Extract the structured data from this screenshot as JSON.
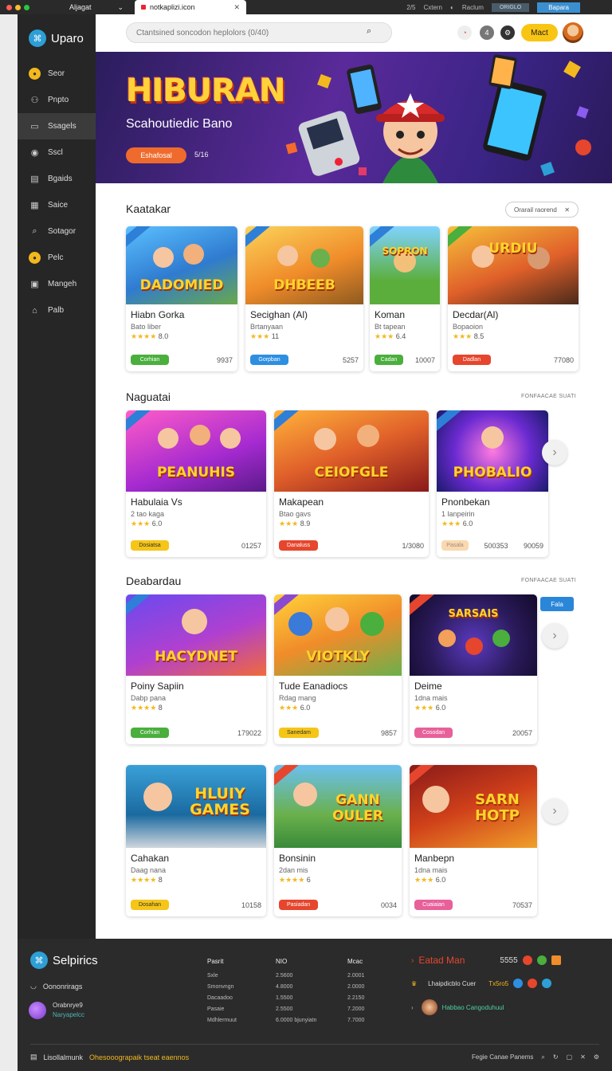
{
  "browser": {
    "tab_inactive": "Aljagat",
    "tab_active": "notkaplizi.icon",
    "right_items": [
      "2/5",
      "Cxtern",
      "Raclum"
    ],
    "btn1": "ORIGLO",
    "btn2": "Bapara"
  },
  "sidebar": {
    "brand": "Uparo",
    "items": [
      {
        "label": "Seor",
        "icon": "coin-icon"
      },
      {
        "label": "Pnpto",
        "icon": "user-icon"
      },
      {
        "label": "Ssagels",
        "icon": "chat-icon"
      },
      {
        "label": "Sscl",
        "icon": "disc-icon"
      },
      {
        "label": "Bgaids",
        "icon": "document-icon"
      },
      {
        "label": "Saice",
        "icon": "calendar-icon"
      },
      {
        "label": "Sotagor",
        "icon": "search-icon"
      },
      {
        "label": "Pelc",
        "icon": "coin-icon"
      },
      {
        "label": "Mangeh",
        "icon": "image-icon"
      },
      {
        "label": "Palb",
        "icon": "bank-icon"
      }
    ]
  },
  "topbar": {
    "search_placeholder": "Ctantsined soncodon heplolors (0/40)",
    "badge_count": "4",
    "start_label": "Mact"
  },
  "hero": {
    "title": "HIBURAN",
    "subtitle": "Scahoutiedic Bano",
    "button": "Eshafosal",
    "meta": "5/16"
  },
  "sections": [
    {
      "title": "Kaatakar",
      "filter": "Orarail raorend",
      "cards": [
        {
          "name": "Hiabn Gorka",
          "sub": "Bato liber",
          "rating": "8.0",
          "tag": "Corhian",
          "num": "9937",
          "thumb": "DADOMIED"
        },
        {
          "name": "Secighan (Al)",
          "sub": "Brtanyaan",
          "rating": "11",
          "tag": "Gorpban",
          "num": "5257",
          "thumb": "DHBEEB"
        },
        {
          "name": "Koman",
          "sub": "Bt tapean",
          "rating": "6.4",
          "tag": "Cadan",
          "num": "10007",
          "thumb": "SOPRON"
        },
        {
          "name": "Decdar(Al)",
          "sub": "Bopaoion",
          "rating": "8.5",
          "tag": "Dadlan",
          "num": "77080",
          "thumb": "URDIU"
        }
      ]
    },
    {
      "title": "Naguatai",
      "see_all": "FONFAACAE SUATI",
      "cards": [
        {
          "name": "Habulaia Vs",
          "sub": "2 tao kaga",
          "rating": "6.0",
          "tag": "Dosiatsa",
          "num": "01257",
          "thumb": "PEANUHIS"
        },
        {
          "name": "Makapean",
          "sub": "Btao gavs",
          "rating": "8.9",
          "tag": "Danaluss",
          "num": "1/3080",
          "thumb": "CEIOFGLE"
        },
        {
          "name": "Pnonbekan",
          "sub": "1 lanpeirin",
          "rating": "6.0",
          "tag": "Pasala",
          "num": "90059",
          "extra": "500353",
          "thumb": "PHOBALIO"
        }
      ]
    },
    {
      "title": "Deabardau",
      "see_all": "FONFAACAE SUATI",
      "new_tag": "Fala",
      "cards": [
        {
          "name": "Poiny Sapiin",
          "sub": "Dabp pana",
          "rating": "8",
          "tag": "Corhian",
          "num": "179022",
          "thumb": "HACYDNET"
        },
        {
          "name": "Tude Eanadiocs",
          "sub": "Rdag mang",
          "rating": "6.0",
          "tag": "Sanedam",
          "num": "9857",
          "thumb": "VIOTKLY"
        },
        {
          "name": "Deime",
          "sub": "1dna mais",
          "rating": "6.0",
          "tag": "Cosodan",
          "num": "20057",
          "thumb": "SARSAIS"
        },
        {
          "name": "Cahakan",
          "sub": "Daag nana",
          "rating": "8",
          "tag": "Dosahan",
          "num": "10158",
          "thumb": "HLUIY GAMES"
        },
        {
          "name": "Bonsinin",
          "sub": "2dan mis",
          "rating": "6",
          "tag": "Pasiadan",
          "num": "0034",
          "thumb": "GANN OULER"
        },
        {
          "name": "Manbepn",
          "sub": "1dna mais",
          "rating": "6.0",
          "tag": "Cuaiaian",
          "num": "70537",
          "thumb": "SARN HOTP"
        }
      ]
    }
  ],
  "footer": {
    "brand": "Selpirics",
    "line1": "Oononrirags",
    "user_name": "Orabnrye9",
    "user_status": "Naryapelcc",
    "columns": [
      {
        "head": "Pasrit",
        "rows": [
          "Sxle",
          "Smonvngn",
          "Dacaadoo",
          "Pasaie",
          "Mdhlermuut"
        ]
      },
      {
        "head": "NIO",
        "rows": [
          "2.5600",
          "4.8000",
          "1.5500",
          "2.5500",
          "6.0000 bjunyiatn"
        ]
      },
      {
        "head": "Mcac",
        "rows": [
          "2.0001",
          "2.0000",
          "2.2150",
          "7.2000",
          "7.7000"
        ]
      }
    ],
    "right_title": "Eatad Man",
    "right_count": "5555",
    "right_line2": "Lhaipdicblo Cuer",
    "right_count2": "Tx5ro5",
    "right_line3": "Habbao Cangoduhuul",
    "bottom_text": "Lisollalmunk",
    "bottom_link": "Ohesooograpaik tseat eaennos",
    "bottom_right": "Fegie Canae Panems",
    "colors": {
      "accent": "#f3b81e",
      "primary": "#2d9fd6",
      "danger": "#e6462d",
      "success": "#4aaf3c"
    }
  }
}
